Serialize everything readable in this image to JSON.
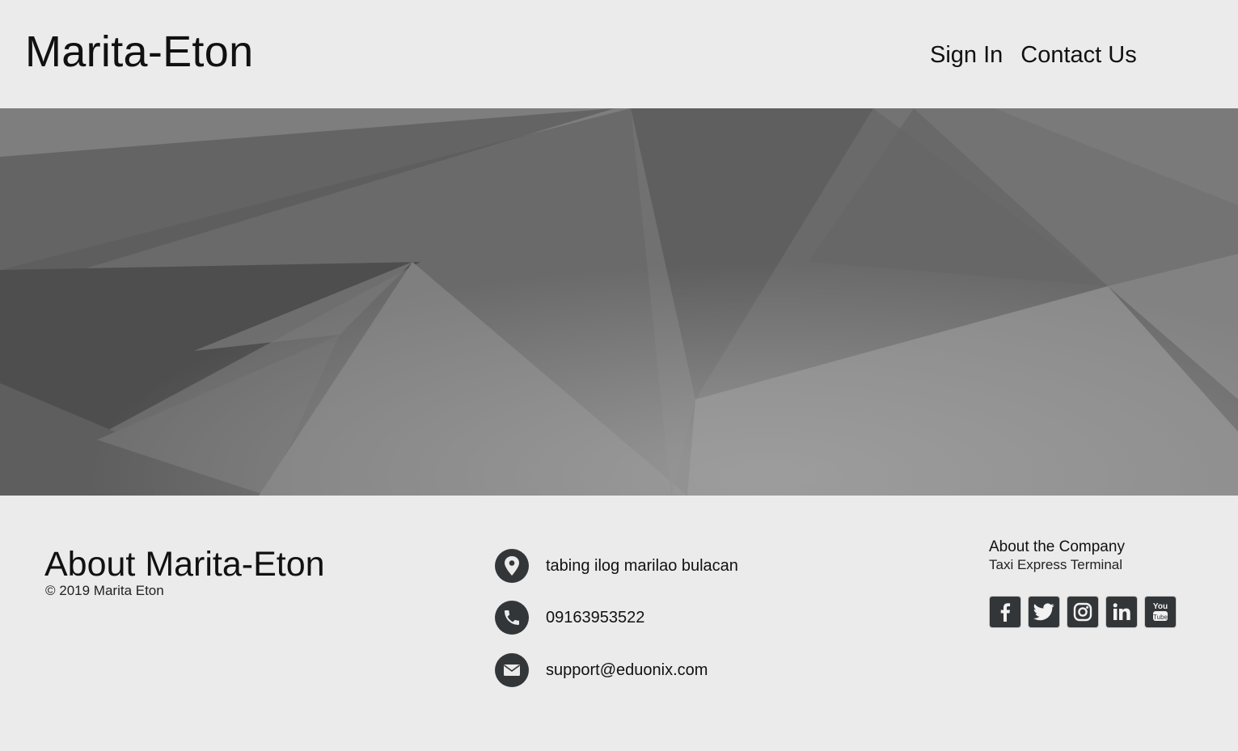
{
  "header": {
    "brand": "Marita-Eton",
    "nav": {
      "sign_in": "Sign In",
      "contact_us": "Contact Us"
    }
  },
  "hero": {
    "background": "gray geometric polygon pattern"
  },
  "footer": {
    "about_title": "About Marita-Eton",
    "copyright": "© 2019 Marita Eton",
    "contact": {
      "address": "tabing ilog marilao bulacan",
      "phone": "09163953522",
      "email": "support@eduonix.com"
    },
    "company": {
      "title": "About the Company",
      "subtitle": "Taxi Express Terminal"
    },
    "socials": [
      {
        "icon": "facebook-icon"
      },
      {
        "icon": "twitter-icon"
      },
      {
        "icon": "instagram-icon"
      },
      {
        "icon": "linkedin-icon"
      },
      {
        "icon": "youtube-icon"
      }
    ]
  },
  "colors": {
    "page_bg": "#ebebeb",
    "icon_bg": "#333638",
    "text": "#111111"
  }
}
